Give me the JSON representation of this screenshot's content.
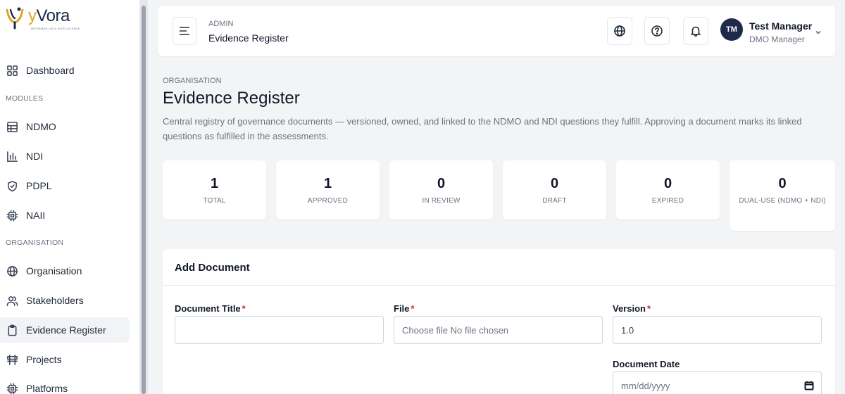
{
  "brand": {
    "name_prefix": "y",
    "name_suffix": "Vora",
    "tagline": "INFORMED DATA INTELLIGENCE"
  },
  "sidebar": {
    "dashboard": "Dashboard",
    "section_modules": "MODULES",
    "modules": [
      {
        "label": "NDMO",
        "icon": "grid-table-icon"
      },
      {
        "label": "NDI",
        "icon": "bar-chart-icon"
      },
      {
        "label": "PDPL",
        "icon": "shield-check-icon"
      },
      {
        "label": "NAII",
        "icon": "chip-icon"
      }
    ],
    "section_org": "ORGANISATION",
    "org_items": [
      {
        "label": "Organisation",
        "icon": "globe-icon"
      },
      {
        "label": "Stakeholders",
        "icon": "users-icon"
      },
      {
        "label": "Evidence Register",
        "icon": "clipboard-icon",
        "active": true
      },
      {
        "label": "Projects",
        "icon": "signpost-icon"
      },
      {
        "label": "Platforms",
        "icon": "chip-icon"
      }
    ]
  },
  "header": {
    "crumb_top": "ADMIN",
    "crumb_main": "Evidence Register",
    "user": {
      "initials": "TM",
      "name": "Test Manager",
      "role": "DMO Manager"
    }
  },
  "page": {
    "eyebrow": "ORGANISATION",
    "title": "Evidence Register",
    "description": "Central registry of governance documents — versioned, owned, and linked to the NDMO and NDI questions they fulfill. Approving a document marks its linked questions as fulfilled in the assessments."
  },
  "stats": [
    {
      "value": "1",
      "label": "TOTAL"
    },
    {
      "value": "1",
      "label": "APPROVED"
    },
    {
      "value": "0",
      "label": "IN REVIEW"
    },
    {
      "value": "0",
      "label": "DRAFT"
    },
    {
      "value": "0",
      "label": "EXPIRED"
    },
    {
      "value": "0",
      "label": "DUAL-USE (NDMO + NDI)"
    }
  ],
  "form": {
    "title": "Add Document",
    "doc_title_label": "Document Title",
    "doc_title_value": "",
    "file_label": "File",
    "file_value": "Choose file No file chosen",
    "version_label": "Version",
    "version_value": "1.0",
    "date_label": "Document Date",
    "date_placeholder": "mm/dd/yyyy",
    "required_mark": "*"
  },
  "colors": {
    "brand_navy": "#1e2a4a",
    "brand_gold": "#e0a524",
    "required": "#dc2626"
  }
}
